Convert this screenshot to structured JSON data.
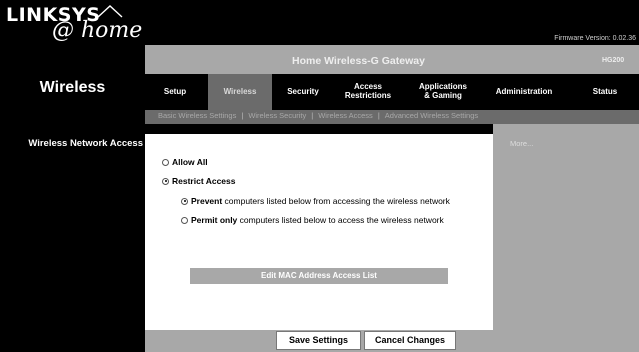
{
  "brand": {
    "name": "LINKSYS",
    "sub": "@ home",
    "firmware": "Firmware Version: 0.02.36"
  },
  "product": {
    "name": "Home Wireless-G Gateway",
    "model": "HG200"
  },
  "section_title": "Wireless",
  "nav": {
    "tabs": [
      {
        "label": "Setup",
        "active": false
      },
      {
        "label": "Wireless",
        "active": true
      },
      {
        "label": "Security",
        "active": false
      },
      {
        "label": "Access\nRestrictions",
        "active": false
      },
      {
        "label": "Applications\n& Gaming",
        "active": false
      },
      {
        "label": "Administration",
        "active": false
      },
      {
        "label": "Status",
        "active": false
      }
    ],
    "subtabs": [
      "Basic Wireless Settings",
      "Wireless Security",
      "Wireless Access",
      "Advanced Wireless Settings"
    ]
  },
  "sidebar": {
    "label": "Wireless Network Access"
  },
  "help": {
    "more": "More..."
  },
  "access": {
    "allow_all": "Allow All",
    "restrict": "Restrict Access",
    "prevent_bold": "Prevent",
    "prevent_rest": " computers listed below from accessing the wireless network",
    "permit_bold": "Permit only",
    "permit_rest": " computers listed below to access the wireless network",
    "edit_button": "Edit MAC Address Access List"
  },
  "actions": {
    "save": "Save Settings",
    "cancel": "Cancel Changes"
  },
  "colors": {
    "black": "#000000",
    "gray": "#a8a8a8",
    "dark_gray": "#6b6b6b"
  }
}
